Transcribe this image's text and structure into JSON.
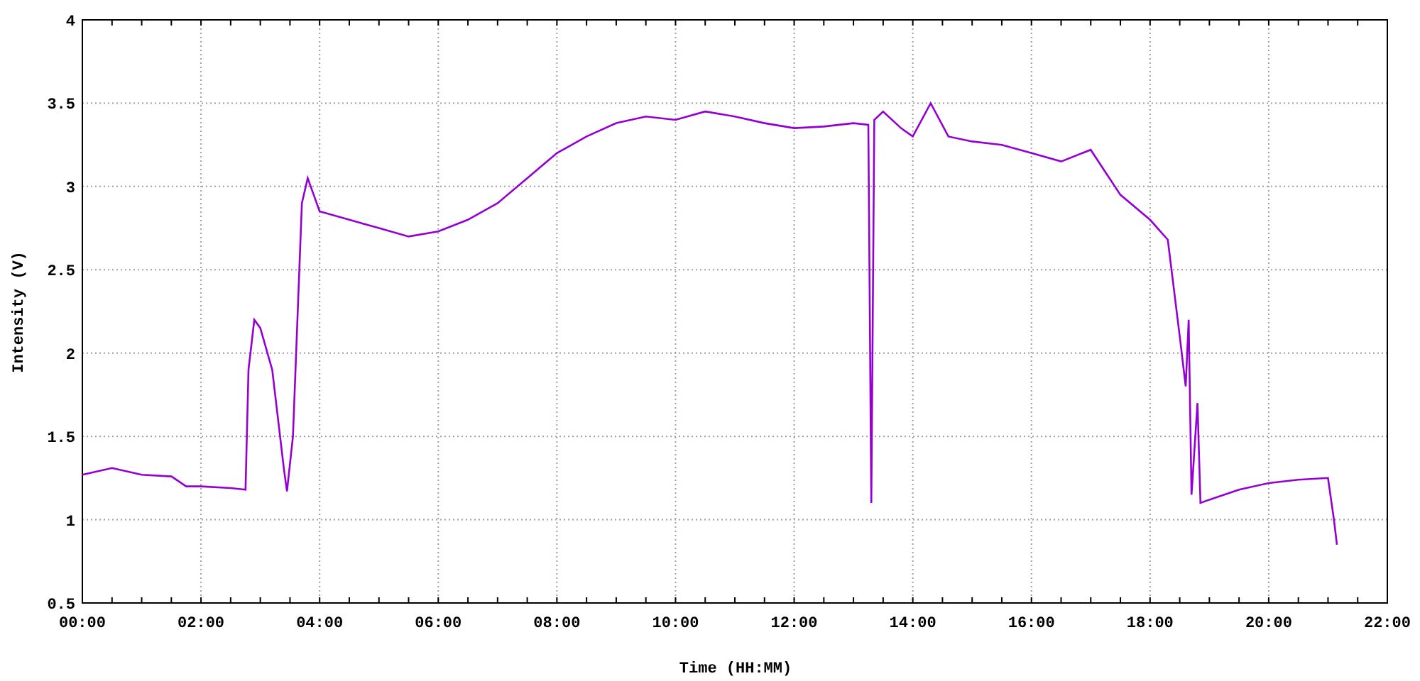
{
  "chart_data": {
    "type": "line",
    "grid": true,
    "xlabel": "Time (HH:MM)",
    "ylabel": "Intensity (V)",
    "xlim": [
      0,
      22
    ],
    "ylim": [
      0.5,
      4
    ],
    "xticks": [
      {
        "value": 0,
        "label": "00:00"
      },
      {
        "value": 2,
        "label": "02:00"
      },
      {
        "value": 4,
        "label": "04:00"
      },
      {
        "value": 6,
        "label": "06:00"
      },
      {
        "value": 8,
        "label": "08:00"
      },
      {
        "value": 10,
        "label": "10:00"
      },
      {
        "value": 12,
        "label": "12:00"
      },
      {
        "value": 14,
        "label": "14:00"
      },
      {
        "value": 16,
        "label": "16:00"
      },
      {
        "value": 18,
        "label": "18:00"
      },
      {
        "value": 20,
        "label": "20:00"
      },
      {
        "value": 22,
        "label": "22:00"
      }
    ],
    "yticks": [
      0.5,
      1,
      {
        "value": 1.5,
        "label": "1.5"
      },
      2,
      {
        "value": 2.5,
        "label": "2.5"
      },
      3,
      {
        "value": 3.5,
        "label": "3.5"
      },
      4
    ],
    "x": [
      0,
      0.5,
      1,
      1.5,
      1.75,
      2,
      2.5,
      2.75,
      2.8,
      2.9,
      3.0,
      3.2,
      3.4,
      3.45,
      3.55,
      3.7,
      3.8,
      4.0,
      4.5,
      5,
      5.5,
      6,
      6.5,
      7,
      7.5,
      8,
      8.5,
      9,
      9.5,
      10,
      10.5,
      11,
      11.5,
      12,
      12.5,
      13,
      13.25,
      13.3,
      13.35,
      13.5,
      13.8,
      14,
      14.3,
      14.6,
      15,
      15.5,
      16,
      16.5,
      17,
      17.5,
      18,
      18.3,
      18.5,
      18.6,
      18.65,
      18.7,
      18.8,
      18.85,
      19,
      19.5,
      20,
      20.5,
      21,
      21.1,
      21.15
    ],
    "series": [
      {
        "color": "#9400d3",
        "values": [
          1.27,
          1.31,
          1.27,
          1.26,
          1.2,
          1.2,
          1.19,
          1.18,
          1.9,
          2.2,
          2.15,
          1.9,
          1.3,
          1.17,
          1.5,
          2.9,
          3.05,
          2.85,
          2.8,
          2.75,
          2.7,
          2.73,
          2.8,
          2.9,
          3.05,
          3.2,
          3.3,
          3.38,
          3.42,
          3.4,
          3.45,
          3.42,
          3.38,
          3.35,
          3.36,
          3.38,
          3.37,
          1.1,
          3.4,
          3.45,
          3.35,
          3.3,
          3.5,
          3.3,
          3.27,
          3.25,
          3.2,
          3.15,
          3.22,
          2.95,
          2.8,
          2.68,
          2.1,
          1.8,
          2.2,
          1.15,
          1.7,
          1.1,
          1.12,
          1.18,
          1.22,
          1.24,
          1.25,
          1.0,
          0.85
        ]
      }
    ]
  }
}
